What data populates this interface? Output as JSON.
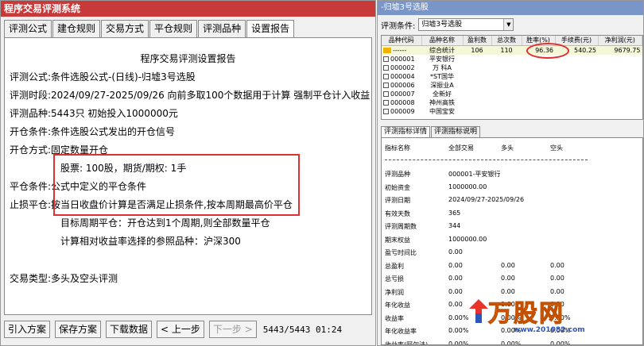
{
  "left": {
    "title": "程序交易评测系统",
    "tabs": [
      "评测公式",
      "建仓规则",
      "交易方式",
      "平仓规则",
      "评测品种",
      "设置报告"
    ],
    "active_tab": 5,
    "report_title": "程序交易评测设置报告",
    "rows": [
      {
        "label": "评测公式:",
        "value": "条件选股公式-(日线)-归墟3号选股"
      },
      {
        "label": "评测时段:",
        "value": "2024/09/27-2025/09/26 向前多取100个数据用于计算 强制平仓计入收益"
      },
      {
        "label": "评测品种:",
        "value": "5443只 初始投入1000000元"
      },
      {
        "label": "开仓条件:",
        "value": "条件选股公式发出的开仓信号"
      },
      {
        "label": "开仓方式:",
        "value": "固定数量开仓"
      },
      {
        "label": "",
        "value": "股票: 100股，期货/期权: 1手"
      },
      {
        "label": "平仓条件:",
        "value": "公式中定义的平仓条件"
      },
      {
        "label": "止损平仓:",
        "value": "按当日收盘价计算是否满足止损条件,按本周期最高价平仓"
      },
      {
        "label": "",
        "value": "目标周期平仓：开仓达到1个周期,则全部数量平仓"
      },
      {
        "label": "",
        "value": "计算相对收益率选择的参照品种：沪深300"
      },
      {
        "label": "交易类型:",
        "value": "多头及空头评测"
      }
    ],
    "buttons": {
      "import": "引入方案",
      "save": "保存方案",
      "download": "下载数据",
      "prev": "< 上一步",
      "next": "下一步 >"
    },
    "progress": "5443/5443 01:24"
  },
  "right": {
    "title": "-归墟3号选股",
    "cond_label": "评测条件:",
    "cond_value": "归墟3号选股",
    "columns": [
      "品种代码",
      "品种名称",
      "盈利数",
      "总次数",
      "胜率(%)",
      "手续费(元)",
      "净利润(元)"
    ],
    "rows": [
      {
        "code": "------",
        "name": "综合统计",
        "win": "106",
        "total": "110",
        "rate": "96.36",
        "fee": "540.25",
        "profit": "9679.75"
      },
      {
        "code": "000001",
        "name": "平安银行",
        "win": "",
        "total": "",
        "rate": "",
        "fee": "",
        "profit": ""
      },
      {
        "code": "000002",
        "name": "万 科A",
        "win": "",
        "total": "",
        "rate": "",
        "fee": "",
        "profit": ""
      },
      {
        "code": "000004",
        "name": "*ST国华",
        "win": "",
        "total": "",
        "rate": "",
        "fee": "",
        "profit": ""
      },
      {
        "code": "000006",
        "name": "深振业A",
        "win": "",
        "total": "",
        "rate": "",
        "fee": "",
        "profit": ""
      },
      {
        "code": "000007",
        "name": "全新好",
        "win": "",
        "total": "",
        "rate": "",
        "fee": "",
        "profit": ""
      },
      {
        "code": "000008",
        "name": "神州高铁",
        "win": "",
        "total": "",
        "rate": "",
        "fee": "",
        "profit": ""
      },
      {
        "code": "000009",
        "name": "中国宝安",
        "win": "",
        "total": "",
        "rate": "",
        "fee": "",
        "profit": ""
      }
    ],
    "detail_tabs": [
      "评测指标详情",
      "评测指标说明"
    ],
    "detail_headers": [
      "指标名称",
      "全部交易",
      "多头",
      "空头"
    ],
    "detail_rows": [
      {
        "name": "评测品种",
        "all": "000001-平安银行",
        "long": "",
        "short": ""
      },
      {
        "name": "初始资金",
        "all": "1000000.00",
        "long": "",
        "short": ""
      },
      {
        "name": "评测日期",
        "all": "2024/09/27-2025/09/26",
        "long": "",
        "short": ""
      },
      {
        "name": "有效天数",
        "all": "365",
        "long": "",
        "short": ""
      },
      {
        "name": "评测周期数",
        "all": "344",
        "long": "",
        "short": ""
      },
      {
        "name": "期末权益",
        "all": "1000000.00",
        "long": "",
        "short": ""
      },
      {
        "name": "盈亏时间比",
        "all": "0.00",
        "long": "",
        "short": ""
      },
      {
        "name": "总盈利",
        "all": "0.00",
        "long": "0.00",
        "short": "0.00"
      },
      {
        "name": "总亏损",
        "all": "0.00",
        "long": "0.00",
        "short": "0.00"
      },
      {
        "name": "净利润",
        "all": "0.00",
        "long": "0.00",
        "short": "0.00"
      },
      {
        "name": "年化收益",
        "all": "0.00",
        "long": "0.00",
        "short": "0.00"
      },
      {
        "name": "收益率",
        "all": "0.00%",
        "long": "0.00%",
        "short": "0.00%"
      },
      {
        "name": "年化收益率",
        "all": "0.00%",
        "long": "0.00%",
        "short": "0.00%"
      },
      {
        "name": "收益率(阿尔法)",
        "all": "0.00%",
        "long": "0.00%",
        "short": "0.00%"
      }
    ]
  },
  "watermark": {
    "text": "万股网",
    "url": "www.201082.com"
  },
  "colors": {
    "left_title": "#c83a3a",
    "right_title": "#7a96c9",
    "highlight": "#e23030",
    "watermark": "#ff7c17"
  }
}
